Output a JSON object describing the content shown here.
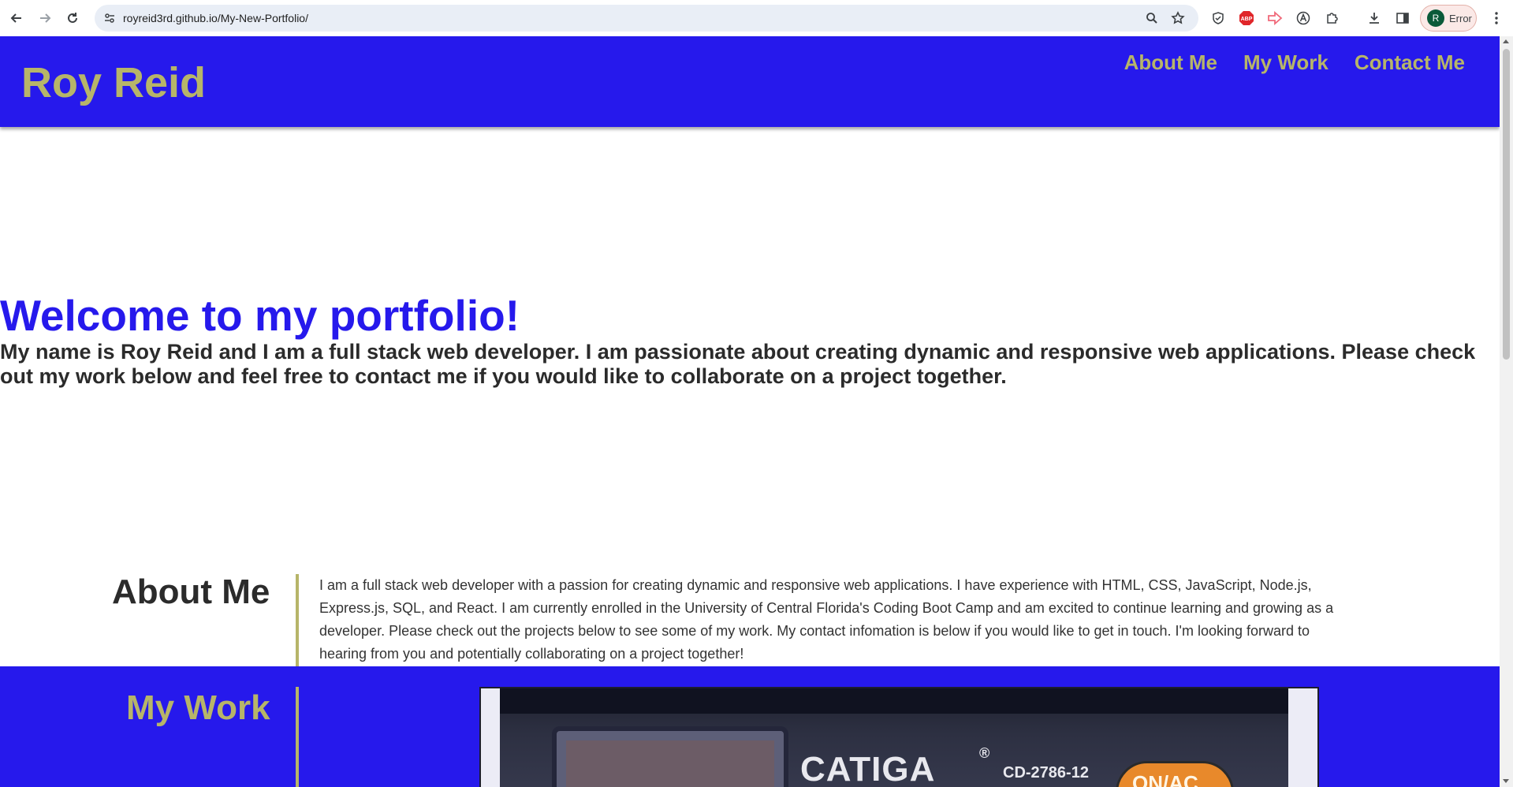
{
  "browser": {
    "url": "royreid3rd.github.io/My-New-Portfolio/",
    "profile_initial": "R",
    "profile_status": "Error",
    "extensions": [
      "shield-icon",
      "abp-icon",
      "arrow-extension-icon",
      "a-circle-icon",
      "puzzle-icon"
    ]
  },
  "header": {
    "title": "Roy Reid",
    "nav": [
      "About Me",
      "My Work",
      "Contact Me"
    ]
  },
  "hero": {
    "title": "Welcome to my portfolio!",
    "text": "My name is Roy Reid and I am a full stack web developer. I am passionate about creating dynamic and responsive web applications. Please check out my work below and feel free to contact me if you would like to collaborate on a project together."
  },
  "about": {
    "heading": "About Me",
    "text": "I am a full stack web developer with a passion for creating dynamic and responsive web applications. I have experience with HTML, CSS, JavaScript, Node.js, Express.js, SQL, and React. I am currently enrolled in the University of Central Florida's Coding Boot Camp and am excited to continue learning and growing as a developer. Please check out the projects below to see some of my work. My contact infomation is below if you would like to get in touch. I'm looking forward to hearing from you and potentially collaborating on a project together!"
  },
  "work": {
    "heading": "My Work",
    "project_image": {
      "brand": "CATIGA",
      "registered": "®",
      "model": "CD-2786-12",
      "button": "ON/AC"
    }
  },
  "colors": {
    "primary": "#2619ec",
    "accent": "#b7b569",
    "text": "#2b2b2b"
  }
}
